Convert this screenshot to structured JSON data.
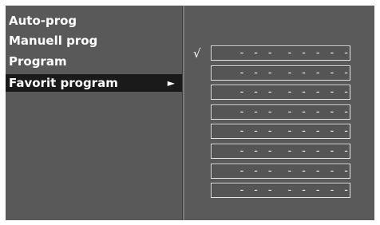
{
  "menu": {
    "items": [
      {
        "label": "Auto-prog"
      },
      {
        "label": "Manuell prog"
      },
      {
        "label": "Program"
      },
      {
        "label": "Favorit program",
        "selected": true,
        "arrow": "►"
      }
    ]
  },
  "favorites": {
    "check_mark": "√",
    "slots": [
      {
        "number": "- - -",
        "name": "- - - - -",
        "checked": true
      },
      {
        "number": "- - -",
        "name": "- - - - -"
      },
      {
        "number": "- - -",
        "name": "- - - - -"
      },
      {
        "number": "- - -",
        "name": "- - - - -"
      },
      {
        "number": "- - -",
        "name": "- - - - -"
      },
      {
        "number": "- - -",
        "name": "- - - - -"
      },
      {
        "number": "- - -",
        "name": "- - - - -"
      },
      {
        "number": "- - -",
        "name": "- - - - -"
      }
    ]
  },
  "colors": {
    "panel_bg": "#5a5a5a",
    "selected_bg": "#1a1a1a",
    "text": "#ffffff",
    "slot_border": "#e6e6e6"
  }
}
